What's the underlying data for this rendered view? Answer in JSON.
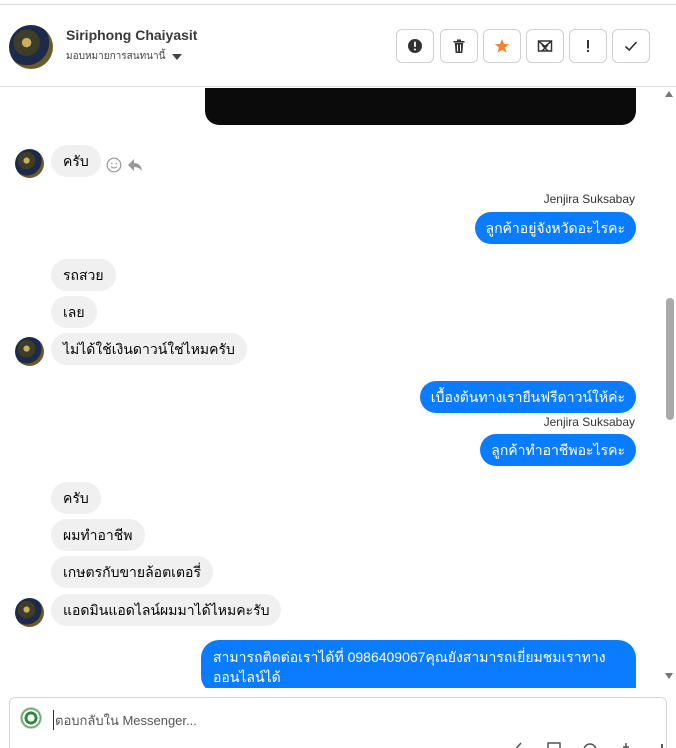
{
  "header": {
    "contact_name": "Siriphong Chaiyasit",
    "assign_label": "มอบหมายการสนทนานี้",
    "toolbar": [
      {
        "name": "alert-circle",
        "icon": "exclamation-circle-icon"
      },
      {
        "name": "delete",
        "icon": "trash-icon"
      },
      {
        "name": "star",
        "icon": "star-icon",
        "color": "#f5832f"
      },
      {
        "name": "mark-unread",
        "icon": "envelope-x-icon"
      },
      {
        "name": "spam",
        "icon": "exclamation-icon"
      },
      {
        "name": "done",
        "icon": "check-icon"
      }
    ]
  },
  "messages": {
    "m1": "ครับ",
    "sender1": "Jenjira Suksabay",
    "m2": "ลูกค้าอยู่จังหวัดอะไรคะ",
    "m3": "รถสวย",
    "m4": "เลย",
    "m5": "ไม่ได้ใช้เงินดาวน์ใช่ไหมครับ",
    "m6": "เบื้องต้นทางเรายืนฟรีดาวน์ให้ค่ะ",
    "sender2": "Jenjira Suksabay",
    "m7": "ลูกค้าทำอาชีพอะไรคะ",
    "m8": "ครับ",
    "m9": "ผมทำอาชีพ",
    "m10": "เกษตรกับขายล้อตเตอรี่",
    "m11": "แอดมินแอดไลน์ผมมาได้ไหมคะรับ",
    "m12_line1": "สามารถติดต่อเราได้ที่ 0986409067คุณยังสามารถเยี่ยมชมเราทาง",
    "m12_line2": "ออนไลน์ได้"
  },
  "composer": {
    "placeholder": "ตอบกลับใน Messenger..."
  },
  "colors": {
    "outgoing_bubble": "#0a7cff",
    "incoming_bubble": "#f0f0f0",
    "star_accent": "#f5832f"
  }
}
